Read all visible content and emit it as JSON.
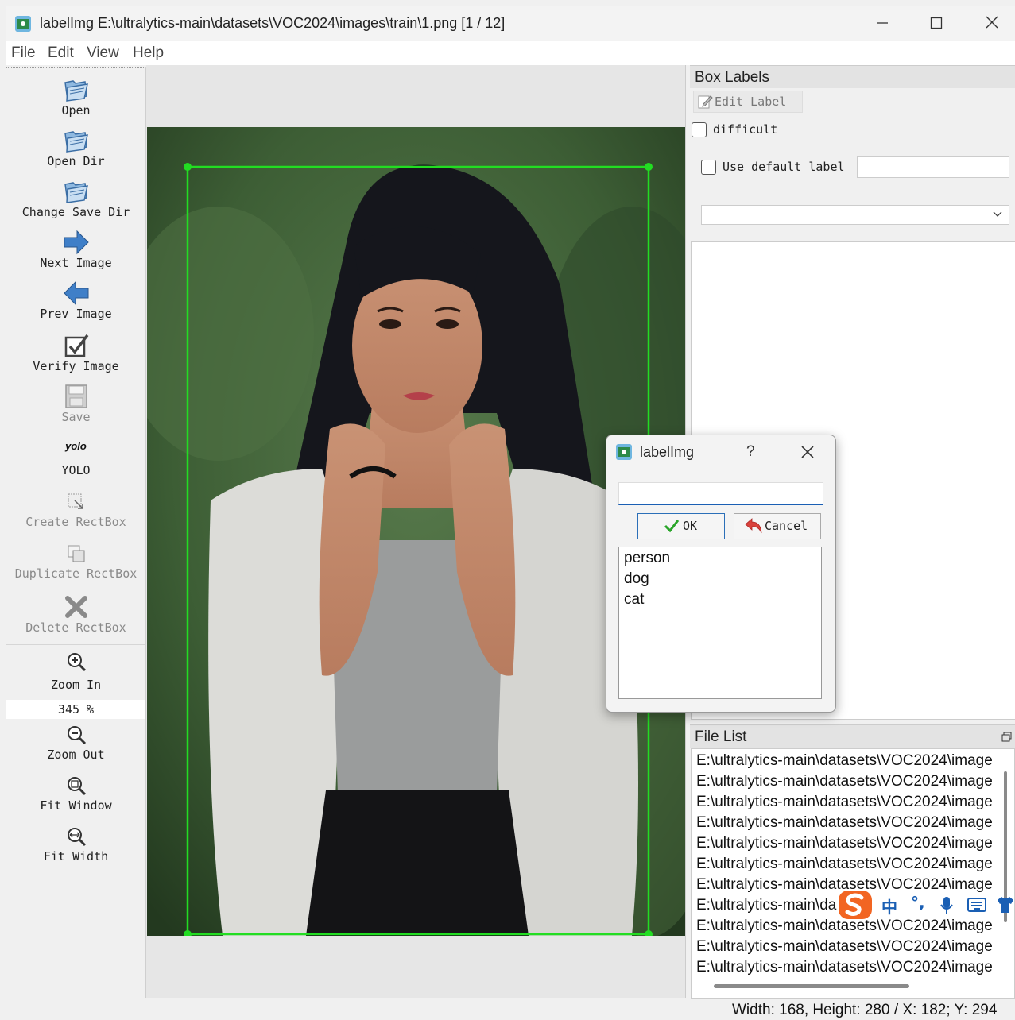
{
  "window": {
    "title": "labelImg E:\\ultralytics-main\\datasets\\VOC2024\\images\\train\\1.png [1 / 12]",
    "controls": [
      "minimize",
      "maximize",
      "close"
    ]
  },
  "menu": {
    "file": "File",
    "edit": "Edit",
    "view": "View",
    "help": "Help"
  },
  "toolbar": {
    "open": "Open",
    "open_dir": "Open Dir",
    "change_save_dir": "Change Save Dir",
    "next_image": "Next Image",
    "prev_image": "Prev Image",
    "verify_image": "Verify Image",
    "save": "Save",
    "yolo_icon_text": "yolo",
    "yolo": "YOLO",
    "create_rectbox": "Create RectBox",
    "duplicate_rectbox": "Duplicate RectBox",
    "delete_rectbox": "Delete RectBox",
    "zoom_in": "Zoom In",
    "zoom_value": "345 %",
    "zoom_out": "Zoom Out",
    "fit_window": "Fit Window",
    "fit_width": "Fit Width"
  },
  "box_labels": {
    "header": "Box Labels",
    "edit_label": "Edit Label",
    "difficult": "difficult",
    "difficult_checked": false,
    "use_default_label": "Use default label",
    "use_default_checked": false,
    "default_label_value": "",
    "combo_value": ""
  },
  "file_list": {
    "header": "File List",
    "items": [
      "E:\\ultralytics-main\\datasets\\VOC2024\\image",
      "E:\\ultralytics-main\\datasets\\VOC2024\\image",
      "E:\\ultralytics-main\\datasets\\VOC2024\\image",
      "E:\\ultralytics-main\\datasets\\VOC2024\\image",
      "E:\\ultralytics-main\\datasets\\VOC2024\\image",
      "E:\\ultralytics-main\\datasets\\VOC2024\\image",
      "E:\\ultralytics-main\\datasets\\VOC2024\\image",
      "E:\\ultralytics-main\\da",
      "E:\\ultralytics-main\\datasets\\VOC2024\\image",
      "E:\\ultralytics-main\\datasets\\VOC2024\\image",
      "E:\\ultralytics-main\\datasets\\VOC2024\\image"
    ]
  },
  "status": "Width: 168, Height: 280 / X: 182; Y: 294",
  "dialog": {
    "title": "labelImg",
    "help": "?",
    "input_value": "",
    "ok": "OK",
    "cancel": "Cancel",
    "labels": [
      "person",
      "dog",
      "cat"
    ]
  },
  "ime": {
    "lang": "中",
    "punct": "°,"
  },
  "colors": {
    "bbox": "#22dd22",
    "accent": "#1a5fb4",
    "arrow": "#3f7fc8"
  }
}
